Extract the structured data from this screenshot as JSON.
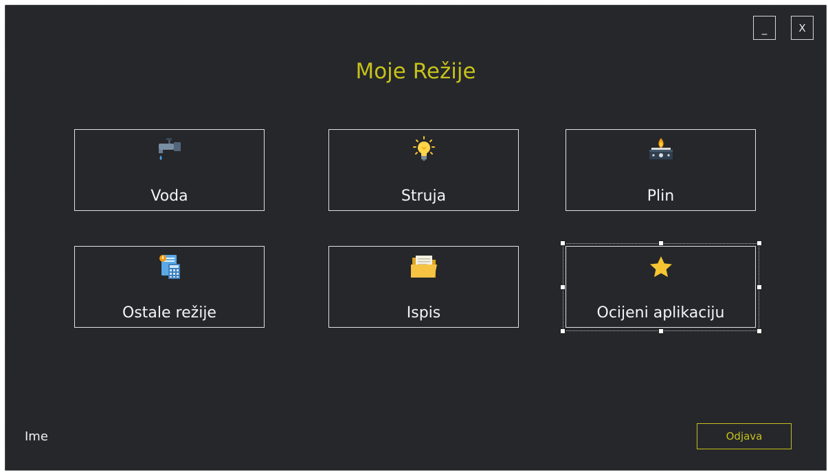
{
  "window": {
    "title": "Moje Režije",
    "minimize_label": "_",
    "close_label": "X"
  },
  "tiles": [
    {
      "label": "Voda",
      "icon": "water-tap-icon"
    },
    {
      "label": "Struja",
      "icon": "light-bulb-icon"
    },
    {
      "label": "Plin",
      "icon": "gas-stove-icon"
    },
    {
      "label": "Ostale režije",
      "icon": "bills-calculator-icon"
    },
    {
      "label": "Ispis",
      "icon": "folder-icon"
    },
    {
      "label": "Ocijeni aplikaciju",
      "icon": "star-icon"
    }
  ],
  "footer": {
    "user_label": "Ime",
    "logout_label": "Odjava"
  },
  "colors": {
    "background": "#26272b",
    "accent": "#c5c21a",
    "tile_border": "#e2e2e2",
    "text": "#f4f4f4"
  }
}
